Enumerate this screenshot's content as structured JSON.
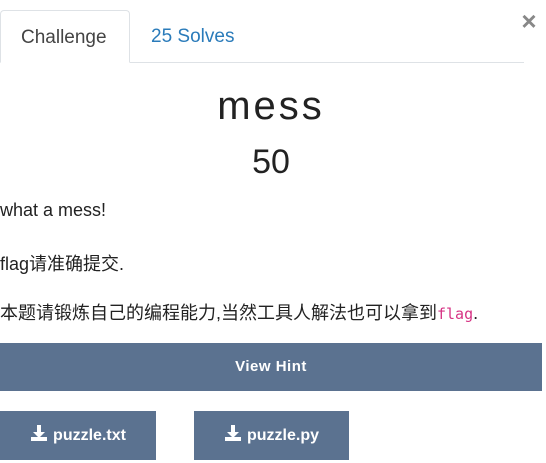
{
  "tabs": {
    "challenge_label": "Challenge",
    "solves_label": "25 Solves"
  },
  "close_icon": "close-icon",
  "challenge": {
    "name": "mess",
    "value": "50",
    "description": {
      "line1": "what a mess!",
      "line2": "flag请准确提交.",
      "line3_text": "本题请锻炼自己的编程能力,当然工具人解法也可以拿到",
      "line3_code": "flag",
      "line3_end": "."
    }
  },
  "hint_button_label": "View Hint",
  "files": [
    {
      "label": "puzzle.txt",
      "icon": "download-icon"
    },
    {
      "label": "puzzle.py",
      "icon": "download-icon"
    }
  ],
  "colors": {
    "button_bg": "#5b7290",
    "tab_link": "#2a7bba",
    "code": "#d63384"
  }
}
